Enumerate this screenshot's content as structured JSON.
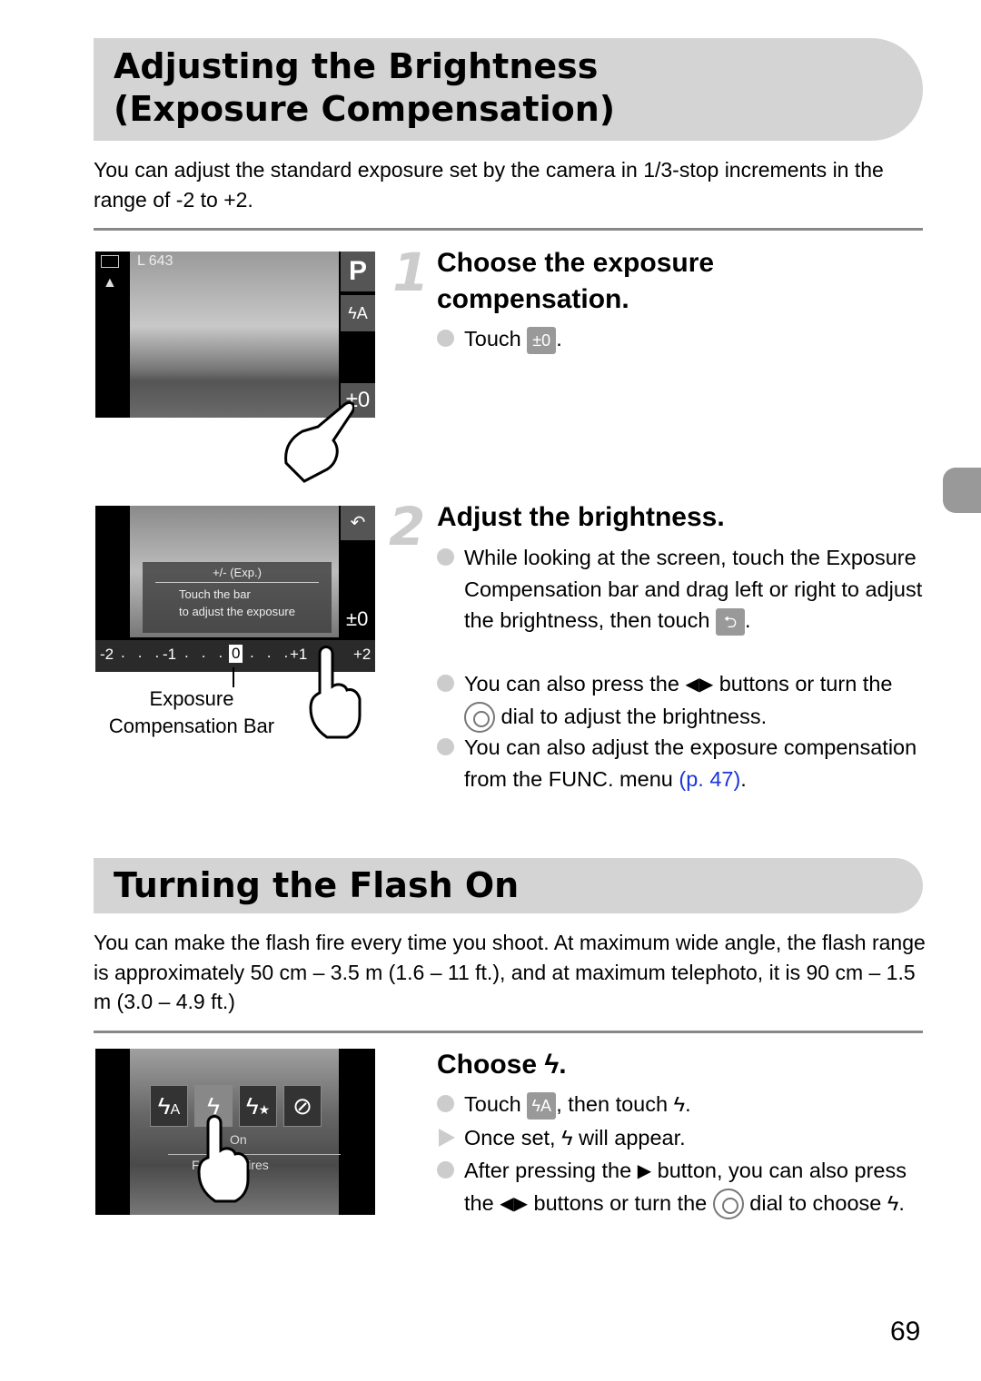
{
  "section1": {
    "title_line1": "Adjusting the Brightness",
    "title_line2": "(Exposure Compensation)",
    "intro": "You can adjust the standard exposure set by the camera in 1/3-stop increments in the range of -2 to +2.",
    "step1": {
      "number": "1",
      "heading_line1": "Choose the exposure",
      "heading_line2": "compensation.",
      "bullet_text": "Touch",
      "bullet_icon": "±0",
      "bullet_end": ".",
      "screen": {
        "counter": "643",
        "mode": "P",
        "flash": "ϟA",
        "exposure": "±0",
        "quality": "L"
      }
    },
    "step2": {
      "number": "2",
      "heading": "Adjust the brightness.",
      "bullets": [
        {
          "text": "While looking at the screen, touch the Exposure Compensation bar and drag left or right to adjust the brightness, then touch",
          "icon": "⮌",
          "end": "."
        },
        {
          "text_a": "You can also press the",
          "icon_arrows": "◀▶",
          "text_b": "buttons or turn the",
          "text_c": "dial to adjust the brightness."
        },
        {
          "text": "You can also adjust the exposure compensation from the FUNC. menu",
          "link": "(p. 47)",
          "end": "."
        }
      ],
      "screen": {
        "popup_title": "+/- (Exp.)",
        "popup_line1": "Touch the bar",
        "popup_line2": "to adjust the exposure",
        "exposure": "±0",
        "scale": [
          "-2",
          "-1",
          "0",
          "+1",
          "+2"
        ]
      },
      "caption_line1": "Exposure",
      "caption_line2": "Compensation Bar"
    }
  },
  "section2": {
    "title": "Turning the Flash On",
    "intro": "You can make the flash fire every time you shoot. At maximum wide angle, the flash range is approximately 50 cm – 3.5 m (1.6 – 11 ft.), and at maximum telephoto, it is 90 cm – 1.5 m (3.0 – 4.9 ft.)",
    "step": {
      "heading": "Choose",
      "heading_end": ".",
      "bullets": [
        {
          "text_a": "Touch",
          "icon": "ϟA",
          "text_b": ", then touch",
          "end": "."
        },
        {
          "text_a": "Once set,",
          "text_b": "will appear."
        },
        {
          "text_a": "After pressing the",
          "text_b": "button, you can also press the",
          "text_c": "buttons or turn the",
          "text_d": "dial",
          "text_e": "to choose",
          "end": "."
        }
      ],
      "screen": {
        "label_on": "On",
        "label_fires": "F          s fires"
      }
    }
  },
  "page_number": "69",
  "colors": {
    "title_bar": "#d4d4d4",
    "link": "#1a35d8",
    "bullet": "#cccccc"
  }
}
